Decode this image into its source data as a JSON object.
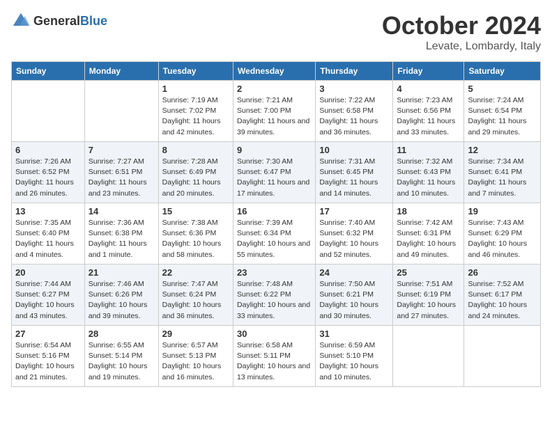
{
  "header": {
    "logo_general": "General",
    "logo_blue": "Blue",
    "month": "October 2024",
    "location": "Levate, Lombardy, Italy"
  },
  "days_of_week": [
    "Sunday",
    "Monday",
    "Tuesday",
    "Wednesday",
    "Thursday",
    "Friday",
    "Saturday"
  ],
  "weeks": [
    [
      {
        "day": "",
        "info": ""
      },
      {
        "day": "",
        "info": ""
      },
      {
        "day": "1",
        "info": "Sunrise: 7:19 AM\nSunset: 7:02 PM\nDaylight: 11 hours and 42 minutes."
      },
      {
        "day": "2",
        "info": "Sunrise: 7:21 AM\nSunset: 7:00 PM\nDaylight: 11 hours and 39 minutes."
      },
      {
        "day": "3",
        "info": "Sunrise: 7:22 AM\nSunset: 6:58 PM\nDaylight: 11 hours and 36 minutes."
      },
      {
        "day": "4",
        "info": "Sunrise: 7:23 AM\nSunset: 6:56 PM\nDaylight: 11 hours and 33 minutes."
      },
      {
        "day": "5",
        "info": "Sunrise: 7:24 AM\nSunset: 6:54 PM\nDaylight: 11 hours and 29 minutes."
      }
    ],
    [
      {
        "day": "6",
        "info": "Sunrise: 7:26 AM\nSunset: 6:52 PM\nDaylight: 11 hours and 26 minutes."
      },
      {
        "day": "7",
        "info": "Sunrise: 7:27 AM\nSunset: 6:51 PM\nDaylight: 11 hours and 23 minutes."
      },
      {
        "day": "8",
        "info": "Sunrise: 7:28 AM\nSunset: 6:49 PM\nDaylight: 11 hours and 20 minutes."
      },
      {
        "day": "9",
        "info": "Sunrise: 7:30 AM\nSunset: 6:47 PM\nDaylight: 11 hours and 17 minutes."
      },
      {
        "day": "10",
        "info": "Sunrise: 7:31 AM\nSunset: 6:45 PM\nDaylight: 11 hours and 14 minutes."
      },
      {
        "day": "11",
        "info": "Sunrise: 7:32 AM\nSunset: 6:43 PM\nDaylight: 11 hours and 10 minutes."
      },
      {
        "day": "12",
        "info": "Sunrise: 7:34 AM\nSunset: 6:41 PM\nDaylight: 11 hours and 7 minutes."
      }
    ],
    [
      {
        "day": "13",
        "info": "Sunrise: 7:35 AM\nSunset: 6:40 PM\nDaylight: 11 hours and 4 minutes."
      },
      {
        "day": "14",
        "info": "Sunrise: 7:36 AM\nSunset: 6:38 PM\nDaylight: 11 hours and 1 minute."
      },
      {
        "day": "15",
        "info": "Sunrise: 7:38 AM\nSunset: 6:36 PM\nDaylight: 10 hours and 58 minutes."
      },
      {
        "day": "16",
        "info": "Sunrise: 7:39 AM\nSunset: 6:34 PM\nDaylight: 10 hours and 55 minutes."
      },
      {
        "day": "17",
        "info": "Sunrise: 7:40 AM\nSunset: 6:32 PM\nDaylight: 10 hours and 52 minutes."
      },
      {
        "day": "18",
        "info": "Sunrise: 7:42 AM\nSunset: 6:31 PM\nDaylight: 10 hours and 49 minutes."
      },
      {
        "day": "19",
        "info": "Sunrise: 7:43 AM\nSunset: 6:29 PM\nDaylight: 10 hours and 46 minutes."
      }
    ],
    [
      {
        "day": "20",
        "info": "Sunrise: 7:44 AM\nSunset: 6:27 PM\nDaylight: 10 hours and 43 minutes."
      },
      {
        "day": "21",
        "info": "Sunrise: 7:46 AM\nSunset: 6:26 PM\nDaylight: 10 hours and 39 minutes."
      },
      {
        "day": "22",
        "info": "Sunrise: 7:47 AM\nSunset: 6:24 PM\nDaylight: 10 hours and 36 minutes."
      },
      {
        "day": "23",
        "info": "Sunrise: 7:48 AM\nSunset: 6:22 PM\nDaylight: 10 hours and 33 minutes."
      },
      {
        "day": "24",
        "info": "Sunrise: 7:50 AM\nSunset: 6:21 PM\nDaylight: 10 hours and 30 minutes."
      },
      {
        "day": "25",
        "info": "Sunrise: 7:51 AM\nSunset: 6:19 PM\nDaylight: 10 hours and 27 minutes."
      },
      {
        "day": "26",
        "info": "Sunrise: 7:52 AM\nSunset: 6:17 PM\nDaylight: 10 hours and 24 minutes."
      }
    ],
    [
      {
        "day": "27",
        "info": "Sunrise: 6:54 AM\nSunset: 5:16 PM\nDaylight: 10 hours and 21 minutes."
      },
      {
        "day": "28",
        "info": "Sunrise: 6:55 AM\nSunset: 5:14 PM\nDaylight: 10 hours and 19 minutes."
      },
      {
        "day": "29",
        "info": "Sunrise: 6:57 AM\nSunset: 5:13 PM\nDaylight: 10 hours and 16 minutes."
      },
      {
        "day": "30",
        "info": "Sunrise: 6:58 AM\nSunset: 5:11 PM\nDaylight: 10 hours and 13 minutes."
      },
      {
        "day": "31",
        "info": "Sunrise: 6:59 AM\nSunset: 5:10 PM\nDaylight: 10 hours and 10 minutes."
      },
      {
        "day": "",
        "info": ""
      },
      {
        "day": "",
        "info": ""
      }
    ]
  ]
}
